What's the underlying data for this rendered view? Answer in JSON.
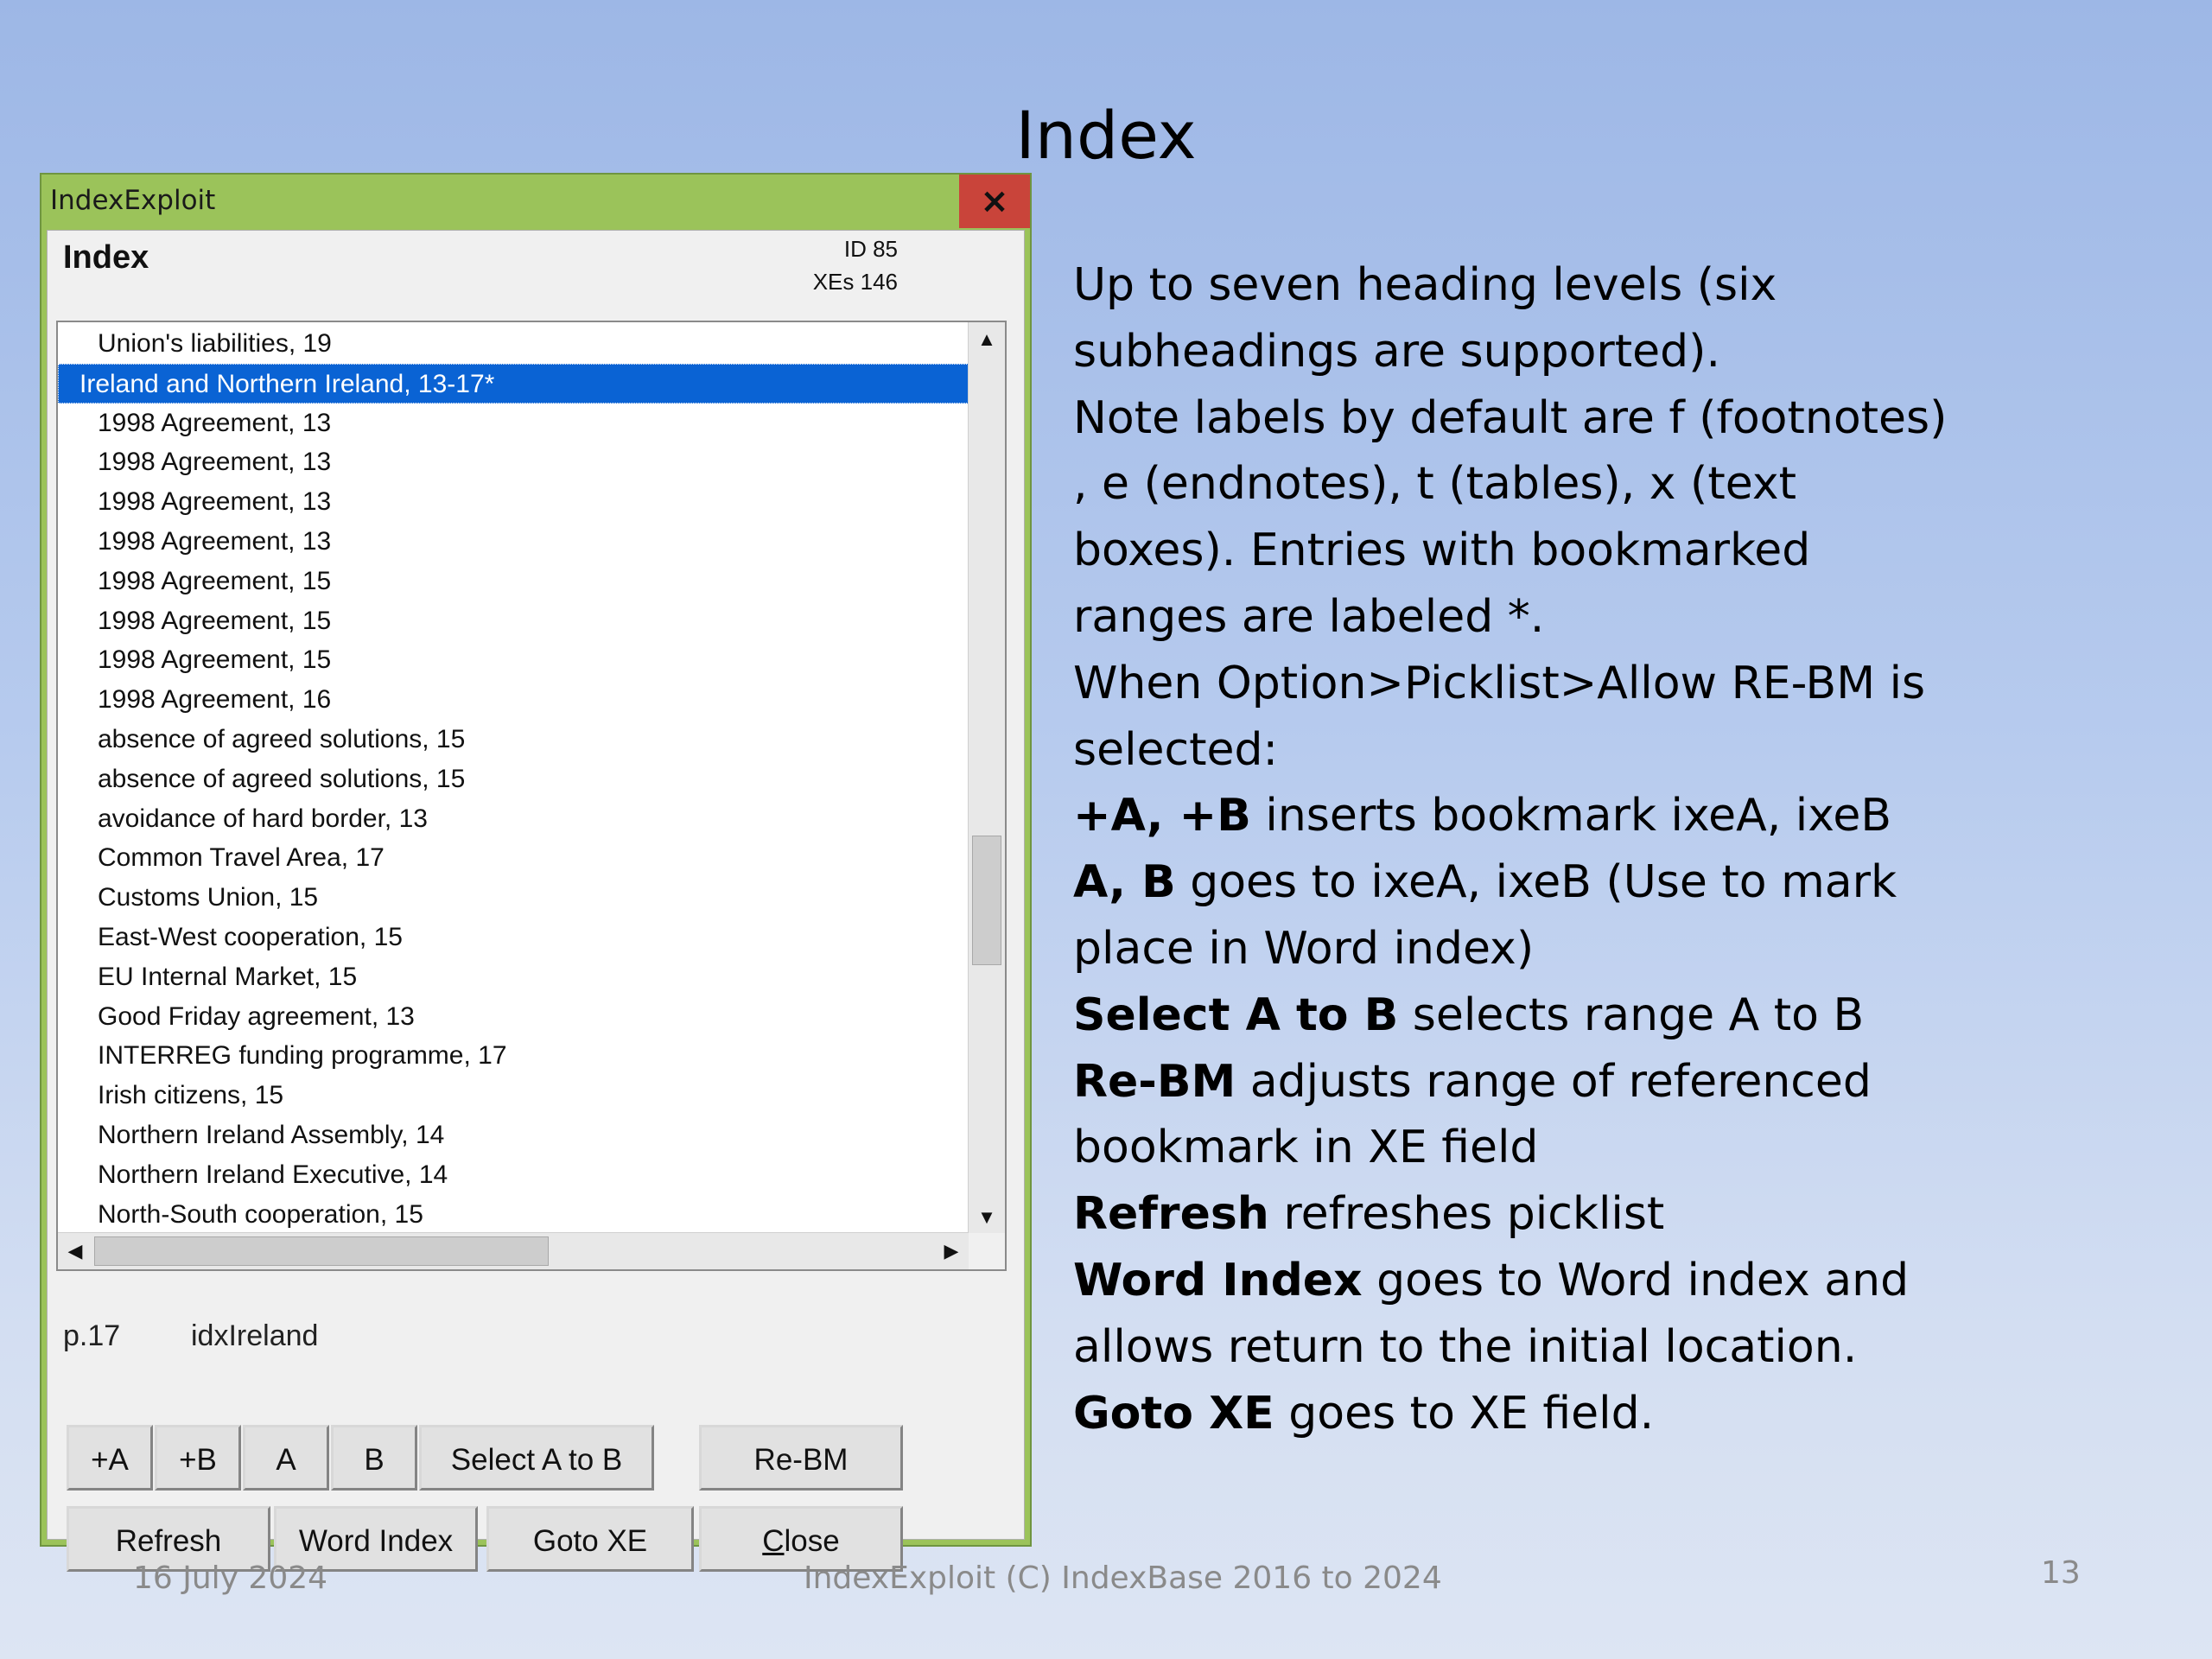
{
  "slide": {
    "title": "Index",
    "footer_date": "16 July 2024",
    "footer_center": "IndexExploit (C) IndexBase 2016 to 2024",
    "page_number": "13"
  },
  "window": {
    "title": "IndexExploit",
    "close_glyph": "×",
    "header_label": "Index",
    "id_text": "ID 85",
    "xes_text": "XEs 146"
  },
  "list": {
    "items": [
      "Union's liabilities, 19",
      "Ireland and Northern Ireland, 13-17*",
      "1998 Agreement, 13",
      "1998 Agreement, 13",
      "1998 Agreement, 13",
      "1998 Agreement, 13",
      "1998 Agreement, 15",
      "1998 Agreement, 15",
      "1998 Agreement, 15",
      "1998 Agreement, 16",
      "absence of agreed solutions, 15",
      "absence of agreed solutions, 15",
      "avoidance of hard border, 13",
      "Common Travel Area, 17",
      "Customs Union, 15",
      "East-West cooperation, 15",
      "EU Internal Market, 15",
      "Good Friday agreement, 13",
      "INTERREG funding programme, 17",
      "Irish citizens, 15",
      "Northern Ireland Assembly, 14",
      "Northern Ireland Executive, 14",
      "North-South cooperation, 15"
    ],
    "selected_index": 1,
    "scroll_up": "▲",
    "scroll_down": "▼",
    "scroll_left": "◀",
    "scroll_right": "▶"
  },
  "status": {
    "page": "p.17",
    "bookmark": "idxIreland"
  },
  "buttons": {
    "plus_a": "+A",
    "plus_b": "+B",
    "a": "A",
    "b": "B",
    "select_a_to_b": "Select A to B",
    "re_bm": "Re-BM",
    "refresh": "Refresh",
    "word_index": "Word Index",
    "goto_xe": "Goto XE",
    "close_rest": "lose",
    "close_mnemonic": "C"
  },
  "description": {
    "l1": "Up to seven heading levels (six",
    "l2": "subheadings are supported).",
    "l3": "Note labels by default are f (footnotes)",
    "l4": ", e (endnotes), t (tables), x (text",
    "l5": "boxes). Entries with bookmarked",
    "l6": "ranges are labeled *.",
    "l7": "When Option>Picklist>Allow RE-BM is",
    "l8": "selected:",
    "l9_bold": "+A, +B",
    "l9_rest": " inserts bookmark ixeA, ixeB",
    "l10_bold": "A, B",
    "l10_rest": " goes to ixeA, ixeB (Use to mark",
    "l11": "place in Word index)",
    "l12_bold": "Select A to B",
    "l12_rest": " selects range A to B",
    "l13_bold": "Re-BM",
    "l13_rest": " adjusts range of referenced",
    "l14": "bookmark in XE field",
    "l15_bold": "Refresh",
    "l15_rest": " refreshes picklist",
    "l16_bold": "Word Index",
    "l16_rest": " goes to Word index and",
    "l17": "allows return to the initial location.",
    "l18_bold": "Goto XE",
    "l18_rest": " goes to XE field."
  }
}
